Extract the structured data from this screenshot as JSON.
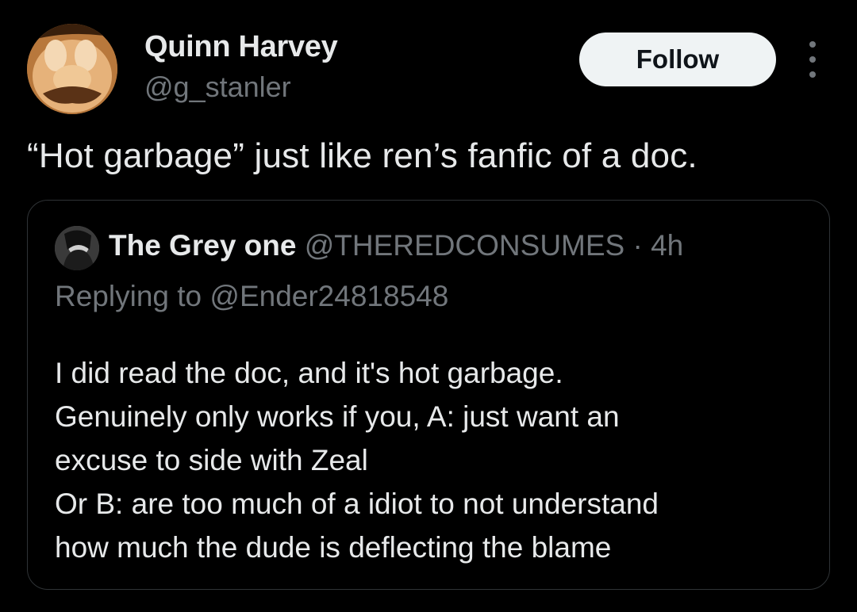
{
  "author": {
    "name": "Quinn Harvey",
    "handle": "@g_stanler",
    "avatar_icon": "mario-face-avatar"
  },
  "follow_label": "Follow",
  "more_icon": "more-vertical-icon",
  "tweet_text": "“Hot garbage” just like ren’s fanfic of a doc.",
  "quoted": {
    "name": "The Grey one",
    "handle": "@THEREDCONSUMES",
    "separator": "·",
    "time": "4h",
    "replying_prefix": "Replying to",
    "replying_to": "@Ender24818548",
    "body_lines": [
      "I did read the doc, and it's hot garbage.",
      "Genuinely only works if you, A: just want an",
      "excuse to side with Zeal",
      "Or B: are too much of a idiot to not understand",
      "how much the dude is deflecting the blame"
    ]
  },
  "colors": {
    "background": "#000000",
    "primary_text": "#e7e9ea",
    "secondary_text": "#71767b",
    "border": "#2f3336",
    "follow_bg": "#eff3f4",
    "follow_text": "#0f1419"
  }
}
